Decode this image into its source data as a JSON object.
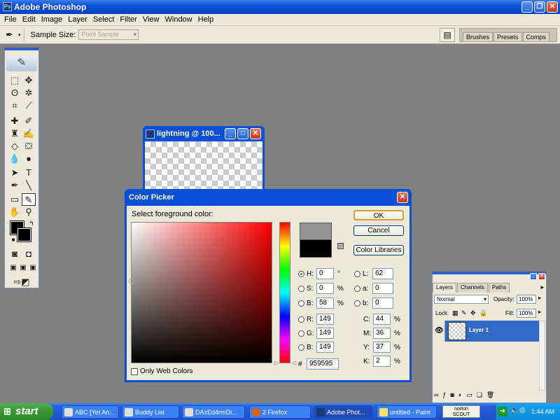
{
  "app": {
    "title": "Adobe Photoshop"
  },
  "menu": [
    "File",
    "Edit",
    "Image",
    "Layer",
    "Select",
    "Filter",
    "View",
    "Window",
    "Help"
  ],
  "options": {
    "sample_size_label": "Sample Size:",
    "sample_size_value": "Point Sample"
  },
  "palette_well": [
    "Brushes",
    "Presets",
    "Comps"
  ],
  "document": {
    "title": "lightning @ 100..."
  },
  "color_picker": {
    "title": "Color Picker",
    "prompt": "Select foreground color:",
    "ok": "OK",
    "cancel": "Cancel",
    "libraries": "Color Libraries",
    "new_color": "#959595",
    "old_color": "#000000",
    "H": "0",
    "S": "0",
    "Bright": "58",
    "R": "149",
    "G": "149",
    "Bval": "149",
    "L": "62",
    "a": "0",
    "b": "0",
    "C": "44",
    "M": "36",
    "Y": "37",
    "K": "2",
    "hex": "959595",
    "only_web": "Only Web Colors",
    "labels": {
      "H": "H:",
      "S": "S:",
      "B": "B:",
      "R": "R:",
      "G": "G:",
      "L": "L:",
      "a": "a:",
      "b": "b:",
      "C": "C:",
      "M": "M:",
      "Y": "Y:",
      "K": "K:",
      "hash": "#"
    },
    "units": {
      "deg": "°",
      "pct": "%"
    }
  },
  "layers": {
    "tabs": [
      "Layers",
      "Channels",
      "Paths"
    ],
    "blend_mode": "Normal",
    "opacity_label": "Opacity:",
    "opacity": "100%",
    "lock_label": "Lock:",
    "fill_label": "Fill:",
    "fill": "100%",
    "layer_name": "Layer 1"
  },
  "taskbar": {
    "start": "start",
    "tasks": [
      "ABC [Yet An...",
      "Buddy List",
      "DAzEd4rmDi...",
      "2 Firefox",
      "Adobe Phot...",
      "untitled - Paint"
    ],
    "norton": "norton\nSCOUT",
    "clock": "1:44 AM"
  }
}
